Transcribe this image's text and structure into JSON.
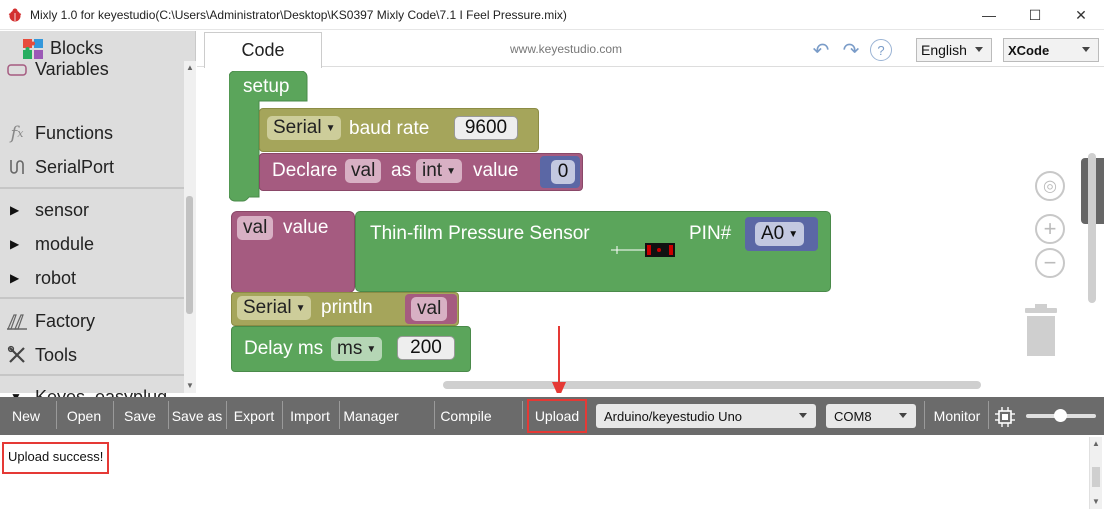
{
  "window": {
    "title": "Mixly 1.0 for keyestudio(C:\\Users\\Administrator\\Desktop\\KS0397 Mixly Code\\7.1 I Feel Pressure.mix)",
    "minimize": "—",
    "maximize": "☐",
    "close": "✕"
  },
  "sidebar": {
    "header": "Blocks",
    "categories": [
      {
        "label": "Variables",
        "icon": "variables-icon"
      },
      {
        "label": "Functions",
        "icon": "functions-icon"
      },
      {
        "label": "SerialPort",
        "icon": "serialport-icon"
      },
      {
        "label": "sensor",
        "icon": "triangle-right-icon"
      },
      {
        "label": "module",
        "icon": "triangle-right-icon"
      },
      {
        "label": "robot",
        "icon": "triangle-right-icon"
      },
      {
        "label": "Factory",
        "icon": "factory-icon"
      },
      {
        "label": "Tools",
        "icon": "tools-icon"
      },
      {
        "label": "Keyes_easyplug",
        "icon": "triangle-down-icon"
      }
    ]
  },
  "topbar": {
    "tab_label": "Code",
    "url": "www.keyestudio.com",
    "help": "?",
    "language_select": "English",
    "theme_select": "XCode"
  },
  "blocks": {
    "setup": "setup",
    "serial_begin": {
      "port": "Serial",
      "text": "baud rate",
      "value": "9600"
    },
    "declare": {
      "prefix": "Declare",
      "var": "val",
      "as": "as",
      "type": "int",
      "text": "value",
      "value": "0"
    },
    "assign": {
      "var": "val",
      "text": "value"
    },
    "sensor": {
      "name": "Thin-film Pressure Sensor",
      "pin_label": "PIN#",
      "pin": "A0"
    },
    "println": {
      "port": "Serial",
      "text": "println",
      "var": "val"
    },
    "delay": {
      "text": "Delay ms",
      "unit": "ms",
      "value": "200"
    }
  },
  "toolbar": {
    "new": "New",
    "open": "Open",
    "save": "Save",
    "save_as": "Save as",
    "export": "Export",
    "import": "Import",
    "manager": "Manager",
    "compile": "Compile",
    "upload": "Upload",
    "board": "Arduino/keyestudio Uno",
    "port": "COM8",
    "monitor": "Monitor"
  },
  "console": {
    "message": "Upload success!"
  },
  "colors": {
    "control_green": "#5ba55b",
    "serial_olive": "#a5a55b",
    "variable_plum": "#a55b80",
    "math_blue": "#5b67a5",
    "toolbar_gray": "#6b6b6b",
    "highlight_red": "#e53935"
  }
}
